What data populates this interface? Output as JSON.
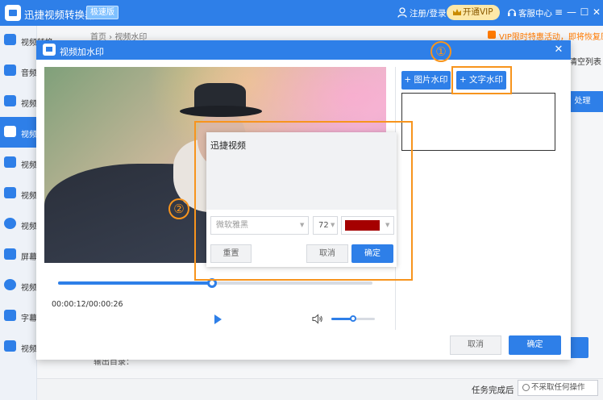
{
  "app": {
    "title": "迅捷视频转换器",
    "badge": "极速版",
    "login": "注册/登录",
    "vip": "开通VIP",
    "service": "客服中心",
    "window_controls": [
      "≡",
      "—",
      "☐",
      "✕"
    ]
  },
  "sidebar": {
    "items": [
      {
        "label": "视频转换",
        "icon": "convert-icon"
      },
      {
        "label": "音频",
        "icon": "audio-icon"
      },
      {
        "label": "视频",
        "icon": "camera-icon"
      },
      {
        "label": "视频",
        "icon": "watermark-icon",
        "active": true
      },
      {
        "label": "视频",
        "icon": "video-icon"
      },
      {
        "label": "视频",
        "icon": "image-icon"
      },
      {
        "label": "视频",
        "icon": "globe-icon"
      },
      {
        "label": "屏幕",
        "icon": "screen-record-icon"
      },
      {
        "label": "视频",
        "icon": "settings-icon"
      },
      {
        "label": "字幕",
        "icon": "subtitle-icon"
      },
      {
        "label": "视频",
        "icon": "video-tool-icon"
      }
    ]
  },
  "background": {
    "breadcrumb": "首页 › 视频水印",
    "promo": "VIP限时特惠活动，即将恢复原价",
    "clear_list": "清空列表",
    "process_button": "处理",
    "output_label": "输出目录：",
    "task_label": "任务完成后",
    "task_option": "不采取任何操作"
  },
  "dialog": {
    "title": "视频加水印",
    "close": "✕",
    "image_watermark_button": "+  图片水印",
    "text_watermark_button": "+  文字水印",
    "time": "00:00:12/00:00:26",
    "progress": 0.49,
    "volume": 0.5,
    "cancel": "取消",
    "ok": "确定",
    "text_popup": {
      "text": "迅捷视频",
      "font": "微软雅黑",
      "size": "72",
      "color": "#a50000",
      "reset": "重置",
      "cancel": "取消",
      "ok": "确定"
    }
  },
  "annotations": {
    "step1": "①",
    "step2": "②",
    "color": "#f7941d"
  },
  "colors": {
    "accent": "#2e7fe8",
    "vip_bg": "#fde8a8"
  }
}
